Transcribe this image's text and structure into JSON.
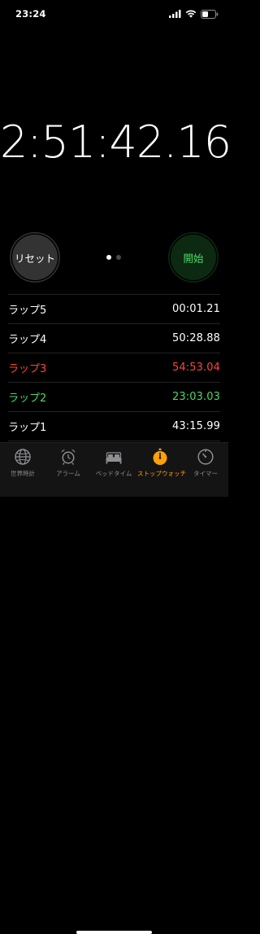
{
  "status_bar": {
    "time": "23:24"
  },
  "stopwatch": {
    "time": "2:51:42.16"
  },
  "controls": {
    "reset_label": "リセット",
    "start_label": "開始",
    "page_count": 2,
    "active_page": 1
  },
  "laps": [
    {
      "label": "ラップ5",
      "time": "00:01.21",
      "color": "#ffffff"
    },
    {
      "label": "ラップ4",
      "time": "50:28.88",
      "color": "#ffffff"
    },
    {
      "label": "ラップ3",
      "time": "54:53.04",
      "color": "#ff4538"
    },
    {
      "label": "ラップ2",
      "time": "23:03.03",
      "color": "#4cd964"
    },
    {
      "label": "ラップ1",
      "time": "43:15.99",
      "color": "#ffffff"
    }
  ],
  "tabs": [
    {
      "label": "世界時計",
      "icon": "globe-icon",
      "active": false
    },
    {
      "label": "アラーム",
      "icon": "alarm-clock-icon",
      "active": false
    },
    {
      "label": "ベッドタイム",
      "icon": "bed-icon",
      "active": false
    },
    {
      "label": "ストップウォッチ",
      "icon": "stopwatch-icon",
      "active": true
    },
    {
      "label": "タイマー",
      "icon": "timer-icon",
      "active": false
    }
  ],
  "colors": {
    "accent": "#ff9f0a",
    "start_green": "#4cd964",
    "lap_worst_red": "#ff4538",
    "tab_inactive": "#8e8e93"
  }
}
